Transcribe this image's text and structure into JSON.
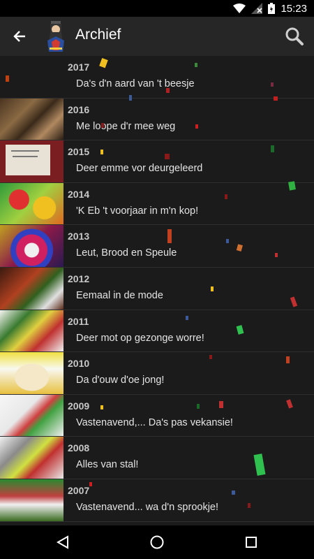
{
  "status_bar": {
    "time": "15:23"
  },
  "app_bar": {
    "title": "Archief"
  },
  "archive": [
    {
      "year": "2017",
      "title": "Da's d'n aard van 't beesje"
    },
    {
      "year": "2016",
      "title": "Me loope d'r mee weg"
    },
    {
      "year": "2015",
      "title": "Deer emme vor deurgeleerd"
    },
    {
      "year": "2014",
      "title": "'K Eb 't voorjaar in m'n kop!"
    },
    {
      "year": "2013",
      "title": "Leut, Brood en Speule"
    },
    {
      "year": "2012",
      "title": "Eemaal in de mode"
    },
    {
      "year": "2011",
      "title": "Deer mot op gezonge worre!"
    },
    {
      "year": "2010",
      "title": "Da d'ouw d'oe jong!"
    },
    {
      "year": "2009",
      "title": "Vastenavend,... Da's pas vekansie!"
    },
    {
      "year": "2008",
      "title": "Alles van stal!"
    },
    {
      "year": "2007",
      "title": "Vastenavend... wa d'n sprookje!"
    }
  ],
  "icons": {
    "back": "arrow-back-icon",
    "search": "search-icon",
    "nav_back": "triangle-back-icon",
    "nav_home": "circle-home-icon",
    "nav_recents": "square-recents-icon"
  },
  "colors": {
    "background": "#1b1b1b",
    "app_bar": "#262626",
    "text": "#e4e4e4"
  }
}
